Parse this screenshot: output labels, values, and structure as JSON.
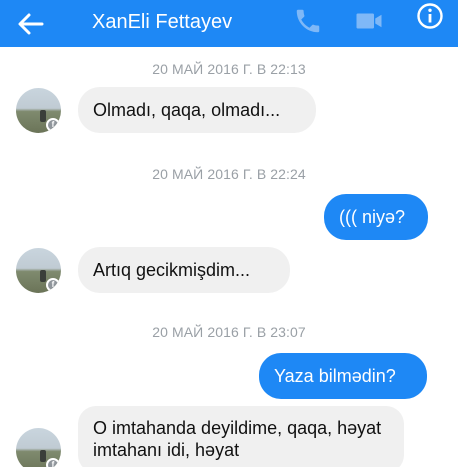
{
  "header": {
    "contact_name": "XanEli Fettayev"
  },
  "messages": [
    {
      "type": "timestamp",
      "text": "20 МАЙ 2016 Г. В 22:13"
    },
    {
      "type": "incoming",
      "text": "Olmadı, qaqa, olmadı..."
    },
    {
      "type": "timestamp",
      "text": "20 МАЙ 2016 Г. В 22:24"
    },
    {
      "type": "outgoing",
      "text": "((( niyə?"
    },
    {
      "type": "incoming",
      "text": "Artıq gecikmişdim..."
    },
    {
      "type": "timestamp",
      "text": "20 МАЙ 2016 Г. В 23:07"
    },
    {
      "type": "outgoing",
      "text": "Yaza bilmədin?"
    },
    {
      "type": "incoming",
      "text": "O imtahanda deyildime, qaqa, həyat imtahanı idi, həyat"
    }
  ],
  "colors": {
    "header_bg": "#1e88f5",
    "outgoing_bubble": "#1e88f5",
    "incoming_bubble": "#f0f0f0",
    "timestamp_text": "#9aa0a6"
  },
  "icons": [
    "back-arrow-icon",
    "phone-icon",
    "video-camera-icon",
    "info-icon",
    "facebook-badge-icon"
  ]
}
